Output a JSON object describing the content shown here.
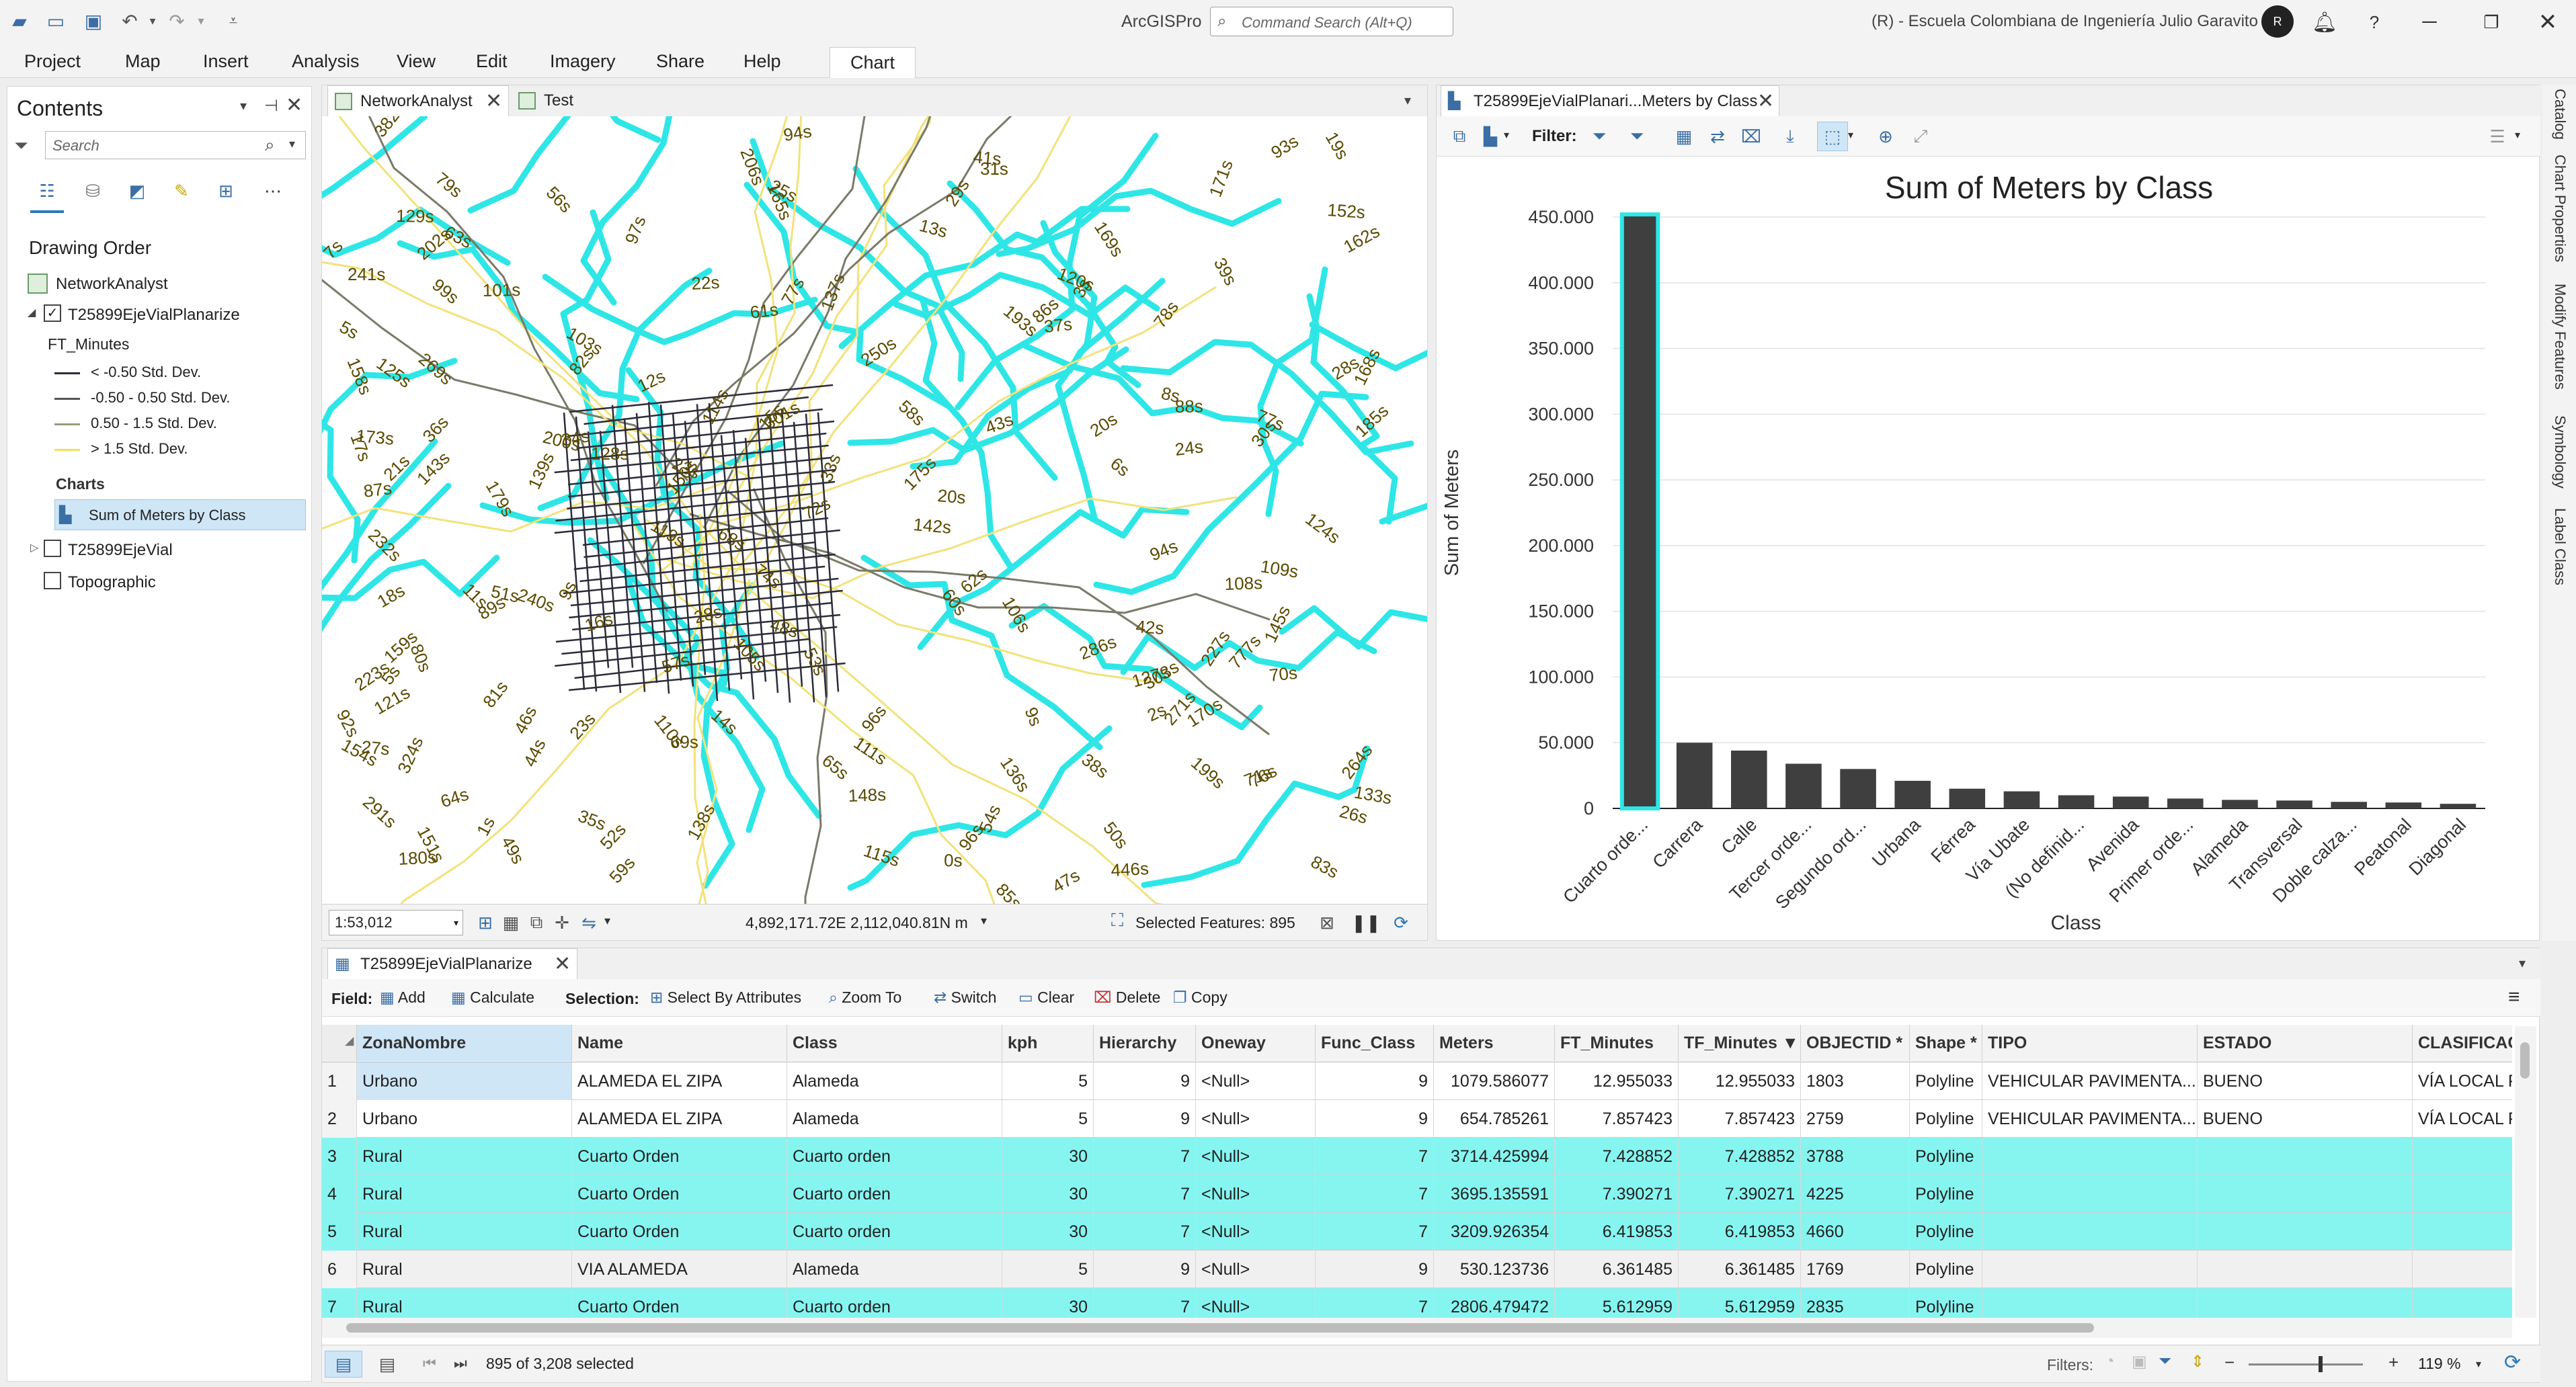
{
  "app": {
    "title": "ArcGISPro",
    "search_placeholder": "Command Search (Alt+Q)",
    "org": "(R) - Escuela Colombiana de Ingeniería Julio Garavito",
    "help": "?"
  },
  "menu": [
    "Project",
    "Map",
    "Insert",
    "Analysis",
    "View",
    "Edit",
    "Imagery",
    "Share",
    "Help",
    "Chart"
  ],
  "contents": {
    "title": "Contents",
    "search_placeholder": "Search",
    "drawing_order": "Drawing Order",
    "map_name": "NetworkAnalyst",
    "layer": "T25899EjeVialPlanarize",
    "field": "FT_Minutes",
    "legend": [
      {
        "label": "< -0.50 Std. Dev.",
        "color": "#2b2b3a"
      },
      {
        "label": "-0.50 - 0.50 Std. Dev.",
        "color": "#555555"
      },
      {
        "label": "0.50 - 1.5 Std. Dev.",
        "color": "#9a9a7a"
      },
      {
        "label": "> 1.5 Std. Dev.",
        "color": "#f0e060"
      }
    ],
    "charts_label": "Charts",
    "chart_item": "Sum of Meters by Class",
    "layer2": "T25899EjeVial",
    "layer3": "Topographic"
  },
  "map": {
    "tabs": [
      "NetworkAnalyst",
      "Test"
    ],
    "scale": "1:53,012",
    "coords": "4,892,171.72E 2,112,040.81N m",
    "selected": "Selected Features: 895",
    "labels": [
      "51s",
      "232s",
      "5s",
      "106s",
      "240s",
      "63s",
      "108s",
      "24s",
      "206s",
      "27s",
      "101s",
      "89s",
      "72s",
      "137s",
      "193s",
      "138s",
      "223s",
      "79s",
      "168s",
      "180s",
      "88s",
      "0s",
      "39s",
      "185s",
      "25s",
      "60s",
      "30s",
      "50s",
      "142s",
      "42s",
      "303s",
      "7s",
      "77s",
      "271s",
      "46s",
      "65s",
      "125s",
      "28s",
      "78s",
      "94s",
      "446s",
      "151s",
      "23s",
      "41s",
      "31s",
      "37s",
      "56s",
      "54s",
      "22s",
      "8s",
      "14s",
      "148s",
      "29s",
      "324s",
      "68s",
      "109s",
      "17s",
      "34s",
      "93s",
      "53s",
      "110s",
      "70s",
      "96s",
      "76s",
      "64s",
      "6s",
      "49s",
      "170s",
      "36s",
      "77s",
      "16s",
      "152s",
      "19s",
      "9s",
      "96s",
      "124s",
      "12s",
      "159s",
      "85s",
      "48s",
      "171s",
      "57s",
      "52s",
      "99s",
      "35s",
      "143s",
      "269s",
      "136s",
      "179s",
      "18s",
      "127s",
      "120s",
      "128s",
      "71s",
      "26s",
      "83s",
      "139s",
      "44s",
      "150s",
      "154s",
      "86s",
      "3s",
      "13s",
      "43s",
      "23s",
      "80s",
      "119s",
      "301s",
      "227s",
      "133s",
      "82s",
      "21s",
      "777s",
      "87s",
      "241s",
      "103s",
      "129s",
      "162s",
      "69s",
      "20s",
      "11s",
      "74s",
      "199s",
      "2s",
      "38s",
      "173s",
      "1s",
      "111s",
      "33s",
      "250s",
      "92s",
      "61s",
      "202s",
      "115s",
      "382s",
      "81s",
      "9s",
      "47s",
      "28s",
      "94s",
      "175s",
      "169s",
      "114s",
      "145s",
      "20s",
      "59s",
      "264s",
      "200s",
      "165s",
      "5s",
      "15s",
      "291s",
      "97s",
      "62s",
      "105s",
      "121s",
      "158s",
      "286s",
      "58s"
    ],
    "colors": {
      "water": "#2ee6e6",
      "road_dark": "#2b2b3a",
      "road_mid": "#7a7a6a",
      "road_yellow": "#f2e27a",
      "label": "#5a4a00"
    }
  },
  "chart": {
    "tab": "T25899EjeVialPlanari...Meters by Class",
    "filter_label": "Filter:",
    "bar_color": "#3f3f3f",
    "highlight_color": "#2ee6e6"
  },
  "chart_data": {
    "type": "bar",
    "title": "Sum of Meters by Class",
    "xlabel": "Class",
    "ylabel": "Sum of Meters",
    "ylim": [
      0,
      450000
    ],
    "yticks": [
      "0",
      "50.000",
      "100.000",
      "150.000",
      "200.000",
      "250.000",
      "300.000",
      "350.000",
      "400.000",
      "450.000"
    ],
    "categories": [
      "Cuarto orde...",
      "Carrera",
      "Calle",
      "Tercer orde...",
      "Segundo ord...",
      "Urbana",
      "Férrea",
      "Vía Ubate",
      "(No definid...",
      "Avenida",
      "Primer orde...",
      "Alameda",
      "Transversal",
      "Doble calza...",
      "Peatonal",
      "Diagonal"
    ],
    "values": [
      452000,
      50000,
      44000,
      34000,
      30000,
      21000,
      15000,
      13000,
      10000,
      9000,
      7500,
      6500,
      6000,
      5000,
      4500,
      3500
    ],
    "selected_index": 0,
    "grid": true,
    "legend": "none"
  },
  "table": {
    "tab": "T25899EjeVialPlanarize",
    "toolbar": {
      "field": "Field:",
      "add": "Add",
      "calculate": "Calculate",
      "selection": "Selection:",
      "select_by_attr": "Select By Attributes",
      "zoom_to": "Zoom To",
      "switch": "Switch",
      "clear": "Clear",
      "delete": "Delete",
      "copy": "Copy"
    },
    "columns": [
      "ZonaNombre",
      "Name",
      "Class",
      "kph",
      "Hierarchy",
      "Oneway",
      "Func_Class",
      "Meters",
      "FT_Minutes",
      "TF_Minutes ▼",
      "OBJECTID *",
      "Shape *",
      "TIPO",
      "ESTADO",
      "CLASIFICAC"
    ],
    "rows": [
      [
        "1",
        "Urbano",
        "ALAMEDA EL ZIPA",
        "Alameda",
        "5",
        "9",
        "<Null>",
        "9",
        "1079.586077",
        "12.955033",
        "12.955033",
        "1803",
        "Polyline",
        "VEHICULAR PAVIMENTA...",
        "BUENO",
        "VÍA LOCAL PA"
      ],
      [
        "2",
        "Urbano",
        "ALAMEDA EL ZIPA",
        "Alameda",
        "5",
        "9",
        "<Null>",
        "9",
        "654.785261",
        "7.857423",
        "7.857423",
        "2759",
        "Polyline",
        "VEHICULAR PAVIMENTA...",
        "BUENO",
        "VÍA LOCAL PA"
      ],
      [
        "3",
        "Rural",
        "Cuarto Orden",
        "Cuarto orden",
        "30",
        "7",
        "<Null>",
        "7",
        "3714.425994",
        "7.428852",
        "7.428852",
        "3788",
        "Polyline",
        "",
        "",
        ""
      ],
      [
        "4",
        "Rural",
        "Cuarto Orden",
        "Cuarto orden",
        "30",
        "7",
        "<Null>",
        "7",
        "3695.135591",
        "7.390271",
        "7.390271",
        "4225",
        "Polyline",
        "",
        "",
        ""
      ],
      [
        "5",
        "Rural",
        "Cuarto Orden",
        "Cuarto orden",
        "30",
        "7",
        "<Null>",
        "7",
        "3209.926354",
        "6.419853",
        "6.419853",
        "4660",
        "Polyline",
        "",
        "",
        ""
      ],
      [
        "6",
        "Rural",
        "VIA ALAMEDA",
        "Alameda",
        "5",
        "9",
        "<Null>",
        "9",
        "530.123736",
        "6.361485",
        "6.361485",
        "1769",
        "Polyline",
        "",
        "",
        ""
      ],
      [
        "7",
        "Rural",
        "Cuarto Orden",
        "Cuarto orden",
        "30",
        "7",
        "<Null>",
        "7",
        "2806.479472",
        "5.612959",
        "5.612959",
        "2835",
        "Polyline",
        "",
        "",
        ""
      ]
    ],
    "selected_rows": [
      2,
      3,
      4,
      6
    ],
    "status": "895 of 3,208 selected",
    "filters_label": "Filters:",
    "zoom": "119 %"
  },
  "side_tabs": [
    "Catalog",
    "Chart Properties",
    "Modify Features",
    "Symbology",
    "Label Class"
  ]
}
